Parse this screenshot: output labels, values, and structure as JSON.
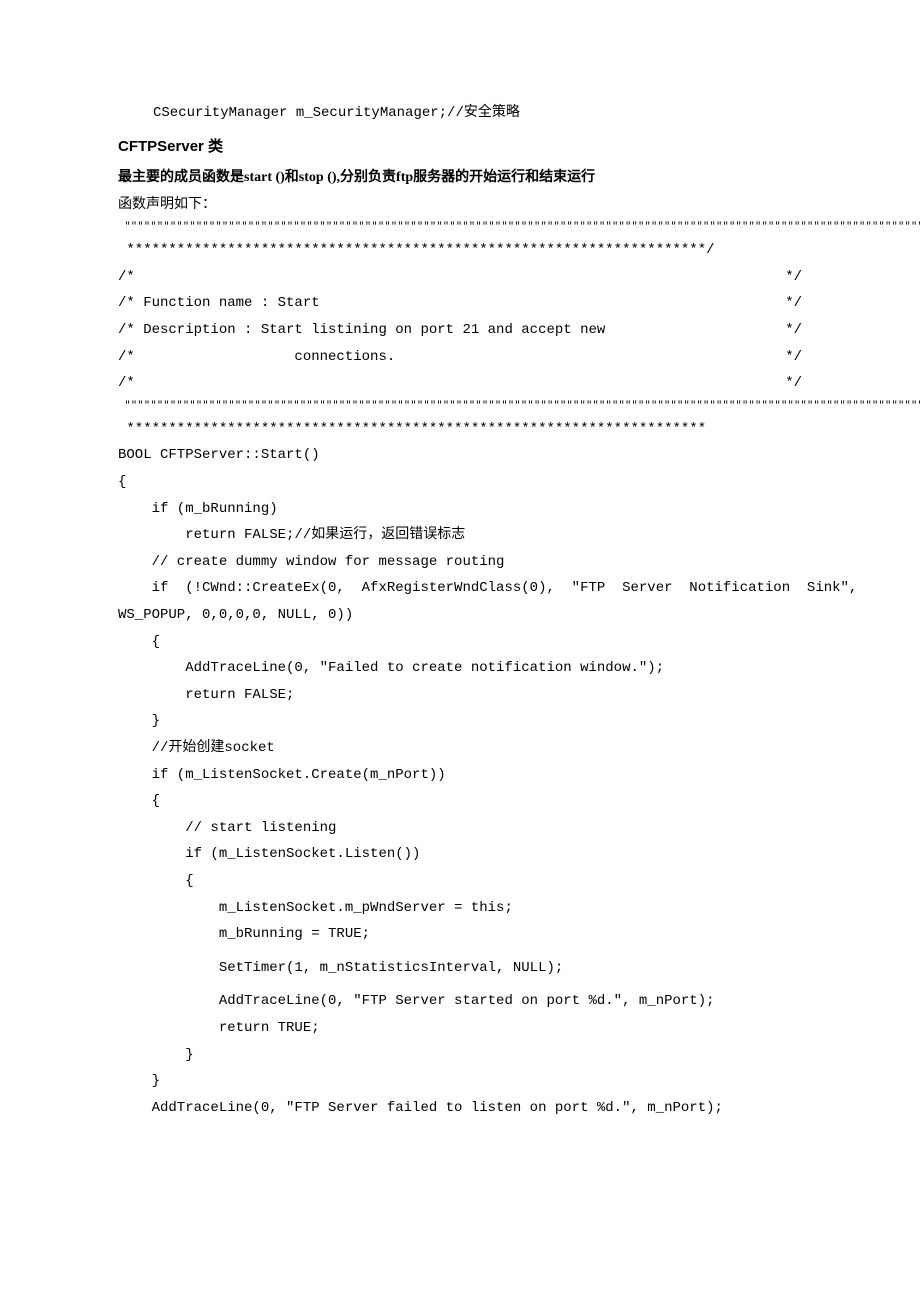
{
  "top_line": "CSecurityManager m_SecurityManager;//安全策略",
  "heading": "CFTPServer 类",
  "desc": "最主要的成员函数是start ()和stop (),分别负责ftp服务器的开始运行和结束运行",
  "decl": "函数声明如下：",
  "stars_top_a": " \"\"\"\"\"\"\"\"\"\"\"\"\"\"\"\"\"\"\"\"\"\"\"\"\"\"\"\"\"\"\"\"\"\"\"\"\"\"\"\"\"\"\"\"\"\"\"\"\"\"\"\"\"\"\"\"\"\"\"\"\"\"\"\"\"\"\"\"\"\"\"\"\"\"\"\"\"\"\"\"\"\"\"\"\"\"\"\"\"\"\"\"\"\"\"\"\"\"\"\"\"\"\"\"\"\"\"\"\"\"\"\"\"\"\"\"\"\"\"\"\"\"\"\"\"\"\"\"\"\"\"\"\"\"\"\"\"\"\"\"\"\"\"\"\"\"\"\"\"\"\"\"\"\"\"\"\"\"\"\"\"\"\"\"\"\"\"\"\"\"\"\"",
  "stars_top_b": " *********************************************************************/",
  "block": {
    "l1": {
      "left": "/*",
      "right": "*/"
    },
    "l2": {
      "left": "/* Function name : Start",
      "right": "*/"
    },
    "l3": {
      "left": "/* Description : Start listining on port 21 and accept new",
      "right": "*/"
    },
    "l4": {
      "left": "/*                   connections.",
      "right": "*/"
    },
    "l5": {
      "left": "/*",
      "right": "*/"
    }
  },
  "stars_bot_a": " \"\"\"\"\"\"\"\"\"\"\"\"\"\"\"\"\"\"\"\"\"\"\"\"\"\"\"\"\"\"\"\"\"\"\"\"\"\"\"\"\"\"\"\"\"\"\"\"\"\"\"\"\"\"\"\"\"\"\"\"\"\"\"\"\"\"\"\"\"\"\"\"\"\"\"\"\"\"\"\"\"\"\"\"\"\"\"\"\"\"\"\"\"\"\"\"\"\"\"\"\"\"\"\"\"\"\"\"\"\"\"\"\"\"\"\"\"\"\"\"\"\"\"\"\"\"\"\"\"\"\"\"\"\"\"\"\"\"\"\"\"\"\"\"\"\"\"\"\"\"\"\"\"\"\"\"\"\"\"\"\"",
  "stars_bot_b": " *********************************************************************",
  "code_lines": {
    "c1": "BOOL CFTPServer::Start()",
    "c2": "{",
    "c3": "    if (m_bRunning)",
    "c4": "        return FALSE;//如果运行，返回错误标志",
    "c5": "    // create dummy window for message routing",
    "c6a": "    if  (!CWnd::CreateEx(0,  AfxRegisterWndClass(0),  \"FTP  Server  Notification  Sink\", ",
    "c6b": "WS_POPUP, 0,0,0,0, NULL, 0))",
    "c7": "    {",
    "c8": "        AddTraceLine(0, \"Failed to create notification window.\");",
    "c9": "        return FALSE;",
    "c10": "    }",
    "c11": "    //开始创建socket",
    "c12": "    if (m_ListenSocket.Create(m_nPort))",
    "c13": "    {",
    "c14": "        // start listening",
    "c15": "        if (m_ListenSocket.Listen())",
    "c16": "        {",
    "c17": "            m_ListenSocket.m_pWndServer = this;",
    "c18": "            m_bRunning = TRUE;",
    "c19": "            SetTimer(1, m_nStatisticsInterval, NULL);",
    "c20": "            AddTraceLine(0, \"FTP Server started on port %d.\", m_nPort);",
    "c21": "            return TRUE;",
    "c22": "        }",
    "c23": "    }",
    "c24": "    AddTraceLine(0, \"FTP Server failed to listen on port %d.\", m_nPort);"
  }
}
